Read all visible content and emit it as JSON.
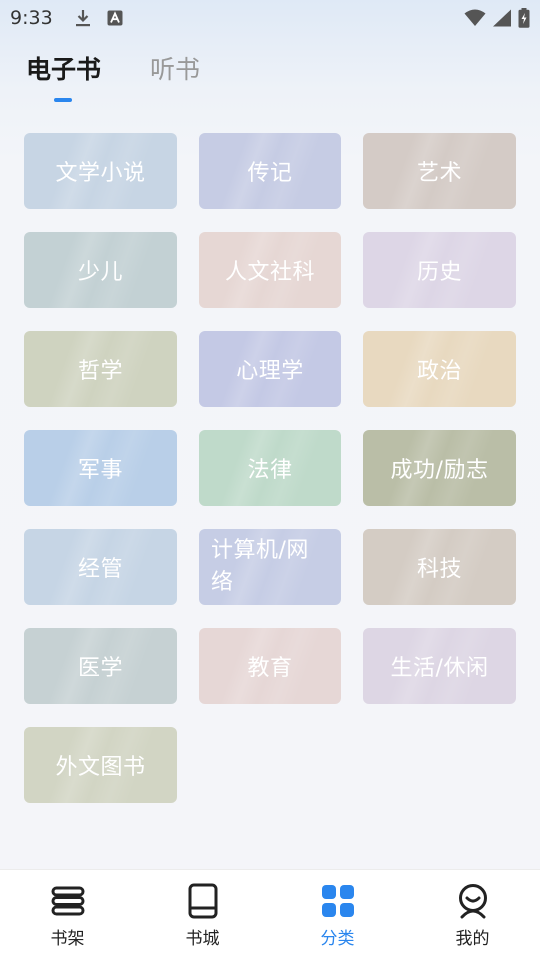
{
  "status_bar": {
    "time": "9:33",
    "left_icons": [
      "download-icon",
      "a-badge-icon"
    ],
    "right_icons": [
      "wifi-icon",
      "signal-icon",
      "battery-charging-icon"
    ]
  },
  "tabs": [
    {
      "label": "电子书",
      "active": true
    },
    {
      "label": "听书",
      "active": false
    }
  ],
  "accent_color": "#2a86ee",
  "categories": [
    {
      "label": "文学小说",
      "color": "#c7d5e4"
    },
    {
      "label": "传记",
      "color": "#c6cce4"
    },
    {
      "label": "艺术",
      "color": "#d4cbc6"
    },
    {
      "label": "少儿",
      "color": "#c3d1d4"
    },
    {
      "label": "人文社科",
      "color": "#e6d7d4"
    },
    {
      "label": "历史",
      "color": "#ddd6e6"
    },
    {
      "label": "哲学",
      "color": "#cfd3c0"
    },
    {
      "label": "心理学",
      "color": "#c4c9e5"
    },
    {
      "label": "政治",
      "color": "#e8d9c0"
    },
    {
      "label": "军事",
      "color": "#b9cfe8"
    },
    {
      "label": "法律",
      "color": "#bfdaca"
    },
    {
      "label": "成功/励志",
      "color": "#babea7"
    },
    {
      "label": "经管",
      "color": "#c6d5e5"
    },
    {
      "label": "计算机/网络",
      "color": "#c6cde5"
    },
    {
      "label": "科技",
      "color": "#d4ccc4"
    },
    {
      "label": "医学",
      "color": "#c6d1d3"
    },
    {
      "label": "教育",
      "color": "#e6d7d6"
    },
    {
      "label": "生活/休闲",
      "color": "#ddd6e4"
    },
    {
      "label": "外文图书",
      "color": "#d2d5c4"
    }
  ],
  "bottom_nav": [
    {
      "label": "书架",
      "icon": "bookshelf-icon",
      "active": false
    },
    {
      "label": "书城",
      "icon": "book-icon",
      "active": false
    },
    {
      "label": "分类",
      "icon": "category-grid-icon",
      "active": true
    },
    {
      "label": "我的",
      "icon": "profile-icon",
      "active": false
    }
  ]
}
